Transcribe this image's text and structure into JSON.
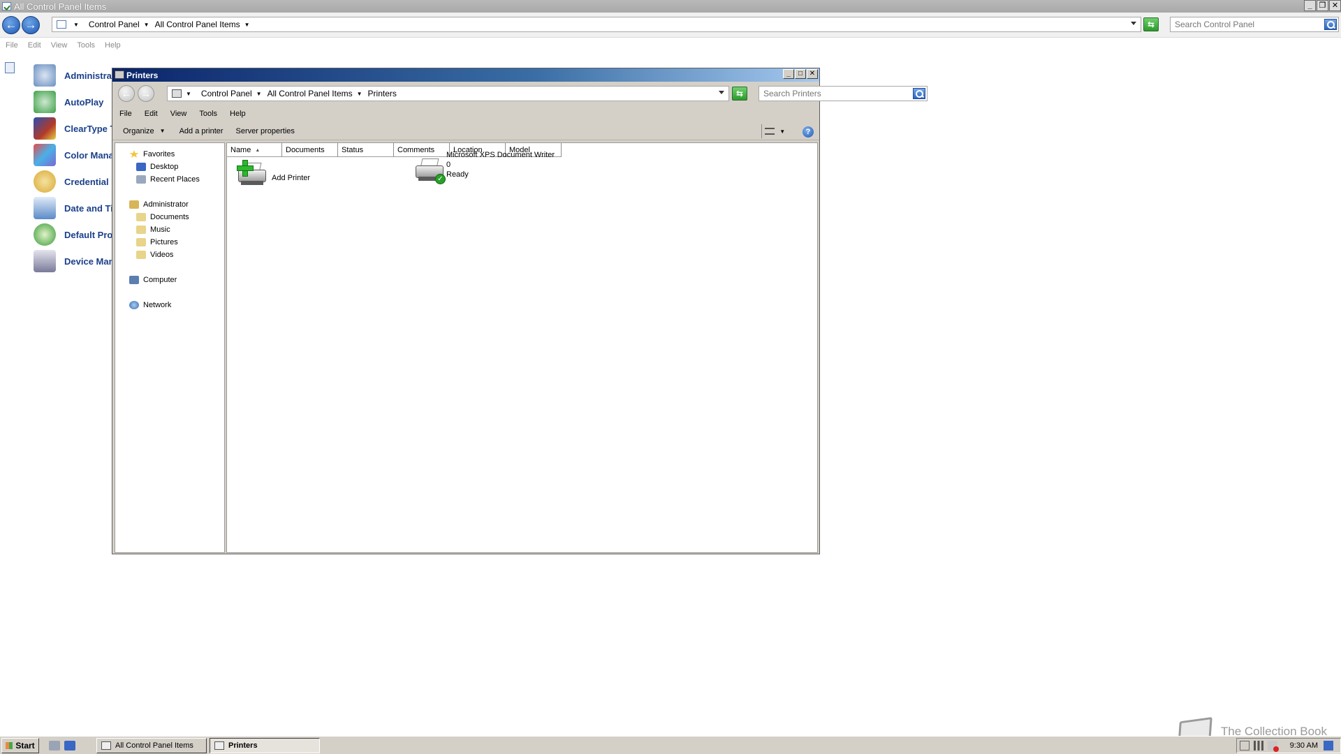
{
  "background_window": {
    "title": "All Control Panel Items",
    "window_buttons": [
      "_",
      "❐",
      "✕"
    ],
    "breadcrumbs": [
      "Control Panel",
      "All Control Panel Items"
    ],
    "search_placeholder": "Search Control Panel",
    "menu": [
      "File",
      "Edit",
      "View",
      "Tools",
      "Help"
    ],
    "items": [
      {
        "label": "Administrat",
        "icon": "gear-tools-icon",
        "color": "#6a8fc0"
      },
      {
        "label": "AutoPlay",
        "icon": "play-icon",
        "color": "#3fa04a"
      },
      {
        "label": "ClearType T",
        "icon": "cleartype-icon",
        "color": "#b23a2a"
      },
      {
        "label": "Color Manag",
        "icon": "color-management-icon",
        "color": "#7a6ad0"
      },
      {
        "label": "Credential M",
        "icon": "key-magnifier-icon",
        "color": "#d8a832"
      },
      {
        "label": "Date and Tir",
        "icon": "calendar-clock-icon",
        "color": "#5b8ac7"
      },
      {
        "label": "Default Prog",
        "icon": "default-programs-icon",
        "color": "#3a9a3a"
      },
      {
        "label": "Device Mana",
        "icon": "device-manager-icon",
        "color": "#7a7a9a"
      }
    ]
  },
  "printers_window": {
    "title": "Printers",
    "window_buttons": [
      "_",
      "□",
      "✕"
    ],
    "breadcrumbs": [
      "Control Panel",
      "All Control Panel Items",
      "Printers"
    ],
    "search_placeholder": "Search Printers",
    "menu": [
      "File",
      "Edit",
      "View",
      "Tools",
      "Help"
    ],
    "toolbar": {
      "organize": "Organize",
      "add_printer": "Add a printer",
      "server_properties": "Server properties",
      "help": "?"
    },
    "nav": {
      "favorites": "Favorites",
      "desktop": "Desktop",
      "recent_places": "Recent Places",
      "administrator": "Administrator",
      "documents": "Documents",
      "music": "Music",
      "pictures": "Pictures",
      "videos": "Videos",
      "computer": "Computer",
      "network": "Network"
    },
    "columns": [
      "Name",
      "Documents",
      "Status",
      "Comments",
      "Location",
      "Model"
    ],
    "items": {
      "add_printer": {
        "name": "Add Printer"
      },
      "xps": {
        "name": "Microsoft XPS Document Writer",
        "documents": "0",
        "status": "Ready"
      }
    }
  },
  "taskbar": {
    "start": "Start",
    "tasks": [
      "All Control Panel Items",
      "Printers"
    ],
    "clock": "9:30 AM"
  },
  "watermark": "The Collection Book"
}
